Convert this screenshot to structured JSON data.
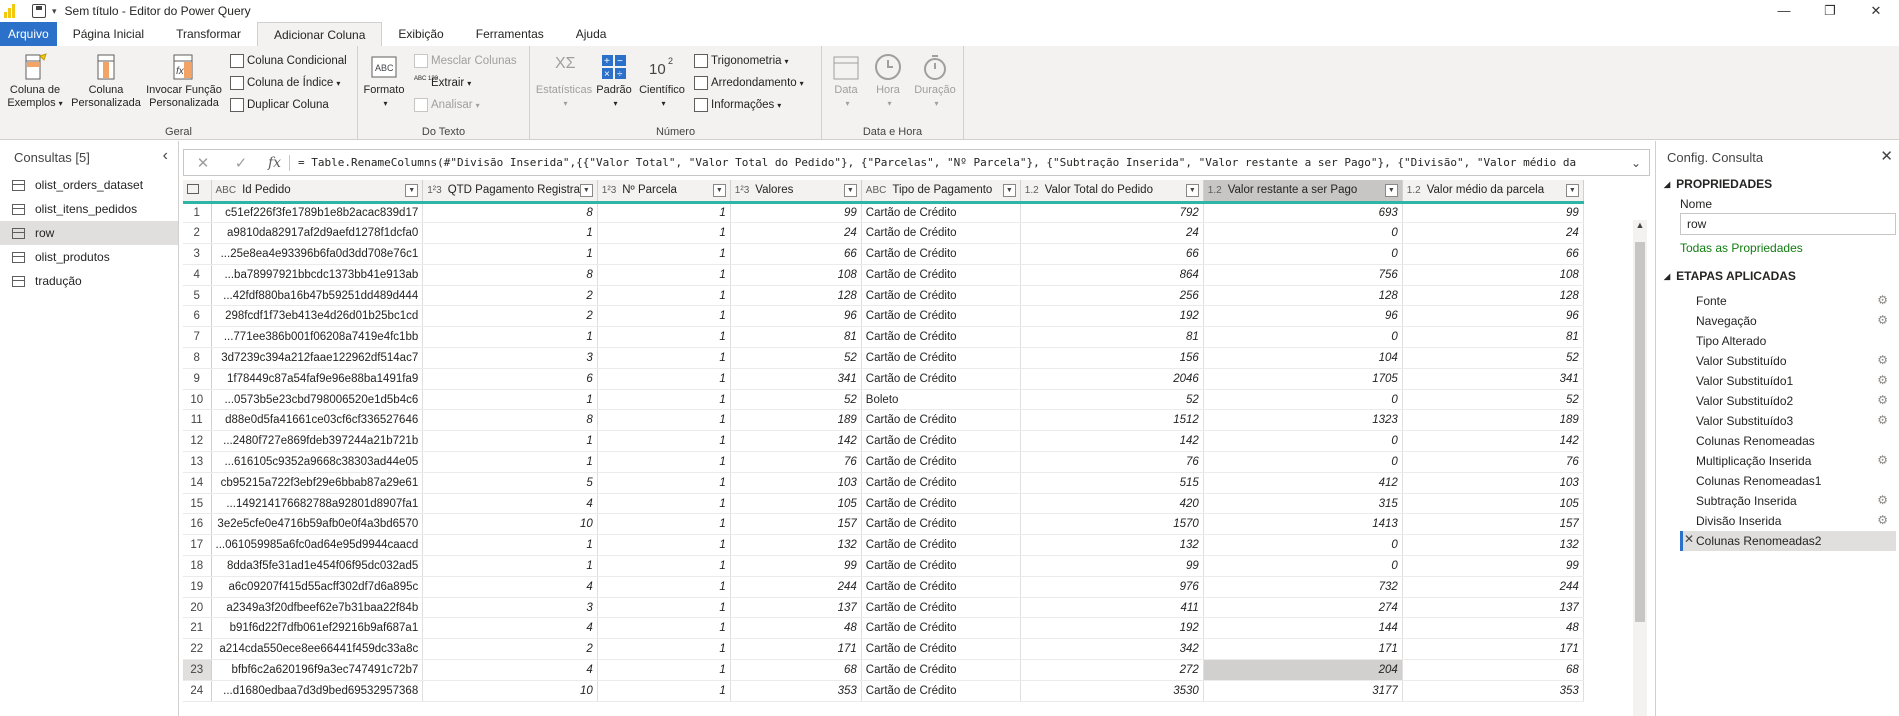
{
  "window": {
    "title": "Sem título - Editor do Power Query"
  },
  "tabs": [
    {
      "label": "Arquivo",
      "kind": "file"
    },
    {
      "label": "Página Inicial",
      "kind": "normal"
    },
    {
      "label": "Transformar",
      "kind": "normal"
    },
    {
      "label": "Adicionar Coluna",
      "kind": "active"
    },
    {
      "label": "Exibição",
      "kind": "normal"
    },
    {
      "label": "Ferramentas",
      "kind": "normal"
    },
    {
      "label": "Ajuda",
      "kind": "normal"
    }
  ],
  "ribbon": {
    "geral": {
      "name": "Geral",
      "coluna_exemplos": "Coluna de Exemplos",
      "coluna_personalizada": "Coluna Personalizada",
      "invocar_funcao": "Invocar Função Personalizada",
      "coluna_condicional": "Coluna Condicional",
      "coluna_indice": "Coluna de Índice",
      "duplicar_coluna": "Duplicar Coluna"
    },
    "texto": {
      "name": "Do Texto",
      "formato": "Formato",
      "mesclar": "Mesclar Colunas",
      "extrair": "Extrair",
      "analisar": "Analisar",
      "abc_icon_text": "ABC",
      "abc123_icon_text": "ABC 123"
    },
    "numero": {
      "name": "Número",
      "estatisticas": "Estatísticas",
      "padrao": "Padrão",
      "cientifico": "Científico",
      "cientifico_icon_text": "10",
      "cientifico_icon_sup": "2",
      "trigonometria": "Trigonometria",
      "arredondamento": "Arredondamento",
      "informacoes": "Informações"
    },
    "data_hora": {
      "name": "Data e Hora",
      "data": "Data",
      "hora": "Hora",
      "duracao": "Duração"
    }
  },
  "left_pane": {
    "title": "Consultas [5]",
    "queries": [
      {
        "label": "olist_orders_dataset",
        "selected": false
      },
      {
        "label": "olist_itens_pedidos",
        "selected": false
      },
      {
        "label": "row",
        "selected": true
      },
      {
        "label": "olist_produtos",
        "selected": false
      },
      {
        "label": "tradução",
        "selected": false
      }
    ]
  },
  "formula": {
    "text": "= Table.RenameColumns(#\"Divisão Inserida\",{{\"Valor Total\", \"Valor Total do  Pedido\"}, {\"Parcelas\", \"Nº Parcela\"}, {\"Subtração Inserida\", \"Valor restante a ser Pago\"}, {\"Divisão\", \"Valor médio da"
  },
  "grid": {
    "columns": [
      {
        "type": "ABC",
        "name": "Id Pedido",
        "align": "idc",
        "width": 152
      },
      {
        "type": "1²3",
        "name": "QTD Pagamento Registrado",
        "align": "num",
        "width": 160
      },
      {
        "type": "1²3",
        "name": "Nº Parcela",
        "align": "num",
        "width": 133
      },
      {
        "type": "1²3",
        "name": "Valores",
        "align": "num",
        "width": 131
      },
      {
        "type": "ABC",
        "name": "Tipo de Pagamento",
        "align": "txt",
        "width": 159
      },
      {
        "type": "1.2",
        "name": "Valor Total do Pedido",
        "align": "num",
        "width": 183
      },
      {
        "type": "1.2",
        "name": "Valor restante a ser Pago",
        "align": "num",
        "width": 199,
        "selected": true
      },
      {
        "type": "1.2",
        "name": "Valor médio da parcela",
        "align": "num",
        "width": 181
      }
    ],
    "selected_row": 23,
    "rows": [
      [
        "c51ef226f3fe1789b1e8b2acac839d17",
        "8",
        "1",
        "99",
        "Cartão de Crédito",
        "792",
        "693",
        "99"
      ],
      [
        "a9810da82917af2d9aefd1278f1dcfa0",
        "1",
        "1",
        "24",
        "Cartão de Crédito",
        "24",
        "0",
        "24"
      ],
      [
        "25e8ea4e93396b6fa0d3dd708e76c1...",
        "1",
        "1",
        "66",
        "Cartão de Crédito",
        "66",
        "0",
        "66"
      ],
      [
        "ba78997921bbcdc1373bb41e913ab...",
        "8",
        "1",
        "108",
        "Cartão de Crédito",
        "864",
        "756",
        "108"
      ],
      [
        "42fdf880ba16b47b59251dd489d444...",
        "2",
        "1",
        "128",
        "Cartão de Crédito",
        "256",
        "128",
        "128"
      ],
      [
        "298fcdf1f73eb413e4d26d01b25bc1cd",
        "2",
        "1",
        "96",
        "Cartão de Crédito",
        "192",
        "96",
        "96"
      ],
      [
        "771ee386b001f06208a7419e4fc1bb...",
        "1",
        "1",
        "81",
        "Cartão de Crédito",
        "81",
        "0",
        "81"
      ],
      [
        "3d7239c394a212faae122962df514ac7",
        "3",
        "1",
        "52",
        "Cartão de Crédito",
        "156",
        "104",
        "52"
      ],
      [
        "1f78449c87a54faf9e96e88ba1491fa9",
        "6",
        "1",
        "341",
        "Cartão de Crédito",
        "2046",
        "1705",
        "341"
      ],
      [
        "0573b5e23cbd798006520e1d5b4c6...",
        "1",
        "1",
        "52",
        "Boleto",
        "52",
        "0",
        "52"
      ],
      [
        "d88e0d5fa41661ce03cf6cf336527646",
        "8",
        "1",
        "189",
        "Cartão de Crédito",
        "1512",
        "1323",
        "189"
      ],
      [
        "2480f727e869fdeb397244a21b721b...",
        "1",
        "1",
        "142",
        "Cartão de Crédito",
        "142",
        "0",
        "142"
      ],
      [
        "616105c9352a9668c38303ad44e05...",
        "1",
        "1",
        "76",
        "Cartão de Crédito",
        "76",
        "0",
        "76"
      ],
      [
        "cb95215a722f3ebf29e6bbab87a29e61",
        "5",
        "1",
        "103",
        "Cartão de Crédito",
        "515",
        "412",
        "103"
      ],
      [
        "149214176682788a92801d8907fa1...",
        "4",
        "1",
        "105",
        "Cartão de Crédito",
        "420",
        "315",
        "105"
      ],
      [
        "3e2e5cfe0e4716b59afb0e0f4a3bd6570",
        "10",
        "1",
        "157",
        "Cartão de Crédito",
        "1570",
        "1413",
        "157"
      ],
      [
        "061059985a6fc0ad64e95d9944caacd...",
        "1",
        "1",
        "132",
        "Cartão de Crédito",
        "132",
        "0",
        "132"
      ],
      [
        "8dda3f5fe31ad1e454f06f95dc032ad5",
        "1",
        "1",
        "99",
        "Cartão de Crédito",
        "99",
        "0",
        "99"
      ],
      [
        "a6c09207f415d55acff302df7d6a895c",
        "4",
        "1",
        "244",
        "Cartão de Crédito",
        "976",
        "732",
        "244"
      ],
      [
        "a2349a3f20dfbeef62e7b31baa22f84b",
        "3",
        "1",
        "137",
        "Cartão de Crédito",
        "411",
        "274",
        "137"
      ],
      [
        "b91f6d22f7dfb061ef29216b9af687a1",
        "4",
        "1",
        "48",
        "Cartão de Crédito",
        "192",
        "144",
        "48"
      ],
      [
        "a214cda550ece8ee66441f459dc33a8c",
        "2",
        "1",
        "171",
        "Cartão de Crédito",
        "342",
        "171",
        "171"
      ],
      [
        "bfbf6c2a620196f9a3ec747491c72b7",
        "4",
        "1",
        "68",
        "Cartão de Crédito",
        "272",
        "204",
        "68"
      ],
      [
        "d1680edbaa7d3d9bed69532957368...",
        "10",
        "1",
        "353",
        "Cartão de Crédito",
        "3530",
        "3177",
        "353"
      ]
    ]
  },
  "right_pane": {
    "title": "Config. Consulta",
    "propriedades": "PROPRIEDADES",
    "nome_label": "Nome",
    "nome_value": "row",
    "todas_propriedades": "Todas as Propriedades",
    "etapas": "ETAPAS APLICADAS",
    "steps": [
      {
        "label": "Fonte",
        "gear": true,
        "current": false
      },
      {
        "label": "Navegação",
        "gear": true,
        "current": false
      },
      {
        "label": "Tipo Alterado",
        "gear": false,
        "current": false
      },
      {
        "label": "Valor Substituído",
        "gear": true,
        "current": false
      },
      {
        "label": "Valor Substituído1",
        "gear": true,
        "current": false
      },
      {
        "label": "Valor Substituído2",
        "gear": true,
        "current": false
      },
      {
        "label": "Valor Substituído3",
        "gear": true,
        "current": false
      },
      {
        "label": "Colunas Renomeadas",
        "gear": false,
        "current": false
      },
      {
        "label": "Multiplicação Inserida",
        "gear": true,
        "current": false
      },
      {
        "label": "Colunas Renomeadas1",
        "gear": false,
        "current": false
      },
      {
        "label": "Subtração Inserida",
        "gear": true,
        "current": false
      },
      {
        "label": "Divisão Inserida",
        "gear": true,
        "current": false
      },
      {
        "label": "Colunas Renomeadas2",
        "gear": false,
        "current": true
      }
    ]
  }
}
